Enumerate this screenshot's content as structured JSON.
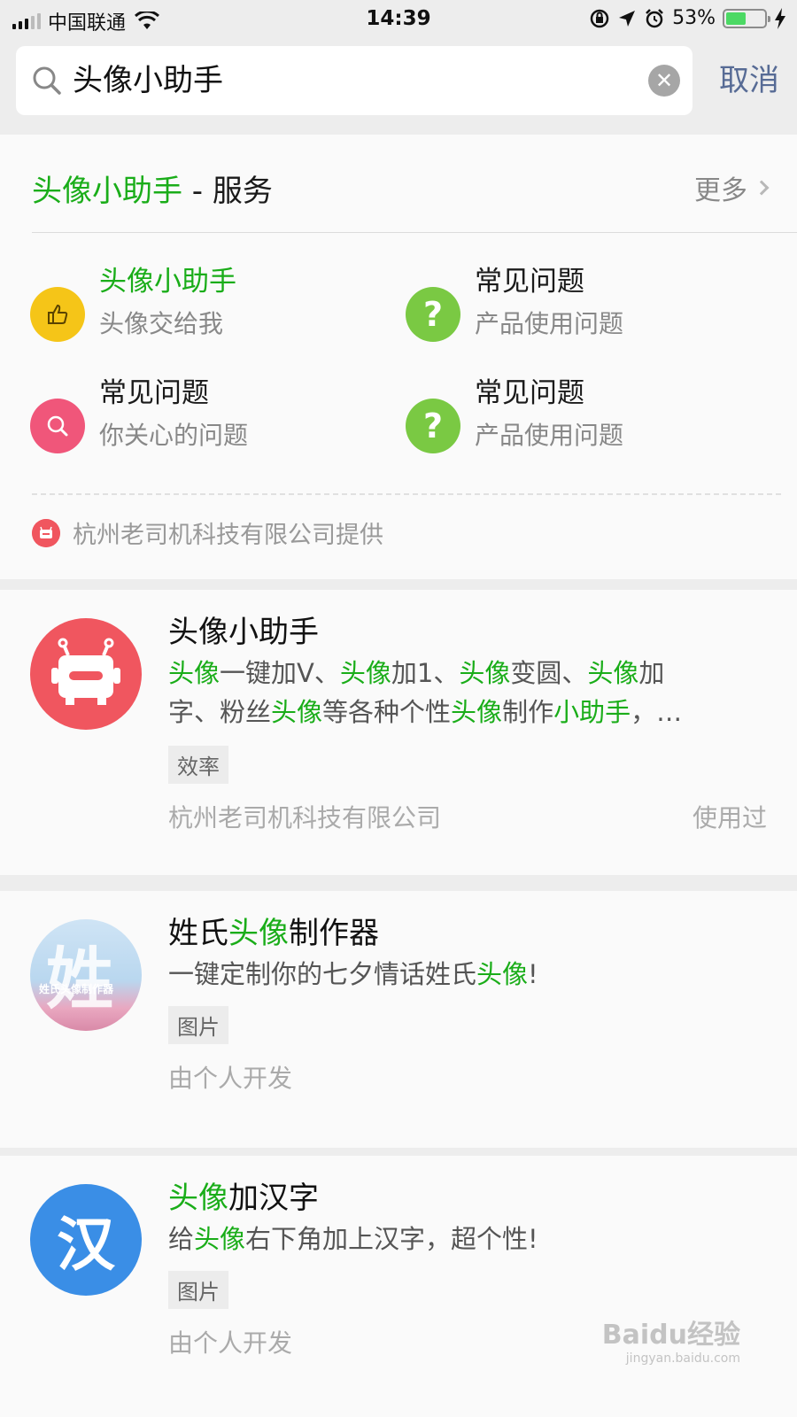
{
  "status_bar": {
    "carrier": "中国联通",
    "time": "14:39",
    "battery": "53%",
    "battery_level": 0.53
  },
  "search": {
    "query": "头像小助手",
    "cancel_label": "取消"
  },
  "services": {
    "title_keyword": "头像小助手",
    "title_suffix": " - 服务",
    "more_label": "更多",
    "items": [
      {
        "title": "头像小助手",
        "subtitle": "头像交给我",
        "icon": "thumbs-up-icon"
      },
      {
        "title": "常见问题",
        "subtitle": "产品使用问题",
        "icon": "question-icon"
      },
      {
        "title": "常见问题",
        "subtitle": "你关心的问题",
        "icon": "search-icon"
      },
      {
        "title": "常见问题",
        "subtitle": "产品使用问题",
        "icon": "question-icon"
      }
    ],
    "provider": "杭州老司机科技有限公司提供"
  },
  "results": [
    {
      "title": "头像小助手",
      "desc_l1": [
        "头像",
        "一键加V、",
        "头像",
        "加1、",
        "头像",
        "变圆、",
        "头像",
        "加"
      ],
      "desc_l2": [
        "字、粉丝",
        "头像",
        "等各种个性",
        "头像",
        "制作",
        "小助手",
        "，…"
      ],
      "tag": "效率",
      "developer": "杭州老司机科技有限公司",
      "used_label": "使用过",
      "avatar": "robot-icon",
      "avatar_color": "#f0565f"
    },
    {
      "title_pre": "姓氏",
      "title_kw": "头像",
      "title_post": "制作器",
      "desc_pre": "一键定制你的七夕情话姓氏",
      "desc_kw": "头像",
      "desc_post": "!",
      "tag": "图片",
      "developer": "由个人开发",
      "avatar_text": "姓",
      "avatar_sub": "姓氏头像制作器"
    },
    {
      "title_kw": "头像",
      "title_post": "加汉字",
      "desc_pre": "给",
      "desc_kw": "头像",
      "desc_post": "右下角加上汉字，超个性!",
      "tag": "图片",
      "developer": "由个人开发",
      "avatar_text": "汉",
      "avatar_color": "#3a8ee6"
    }
  ],
  "watermark": {
    "brand": "Baidu经验",
    "url": "jingyan.baidu.com"
  },
  "colors": {
    "accent_green": "#1aad19",
    "link_blue": "#576b95"
  }
}
